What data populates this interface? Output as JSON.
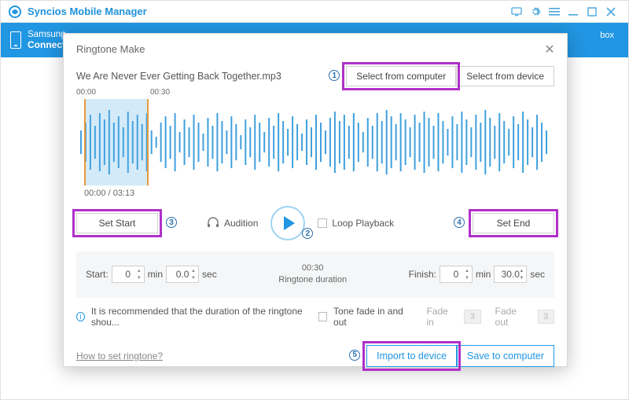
{
  "app": {
    "title": "Syncios Mobile Manager"
  },
  "device": {
    "name": "Samsung",
    "status": "Connect"
  },
  "header_right": "box",
  "modal": {
    "title": "Ringtone Make",
    "filename": "We Are Never Ever Getting Back Together.mp3",
    "btn_select_computer": "Select from computer",
    "btn_select_device": "Select from device",
    "wave": {
      "sel_start_label": "00:00",
      "sel_end_label": "00:30",
      "time_status": "00:00 / 03:13"
    },
    "btn_set_start": "Set Start",
    "btn_set_end": "Set End",
    "audition_label": "Audition",
    "loop_label": "Loop Playback",
    "grey": {
      "start_label": "Start:",
      "start_min": "0",
      "start_sec": "0.0",
      "min_unit": "min",
      "sec_unit": "sec",
      "duration_time": "00:30",
      "duration_label": "Ringtone duration",
      "finish_label": "Finish:",
      "finish_min": "0",
      "finish_sec": "30.0"
    },
    "recommend_text": "It is recommended that the duration of the ringtone shou...",
    "tone_fade_label": "Tone fade in and out",
    "fade_in_label": "Fade in",
    "fade_in_val": "3",
    "fade_out_label": "Fade out",
    "fade_out_val": "3",
    "howto_link": "How to set ringtone?",
    "btn_import": "Import to device",
    "btn_save": "Save to computer"
  },
  "annotations": {
    "n1": "1",
    "n2": "2",
    "n3": "3",
    "n4": "4",
    "n5": "5"
  }
}
